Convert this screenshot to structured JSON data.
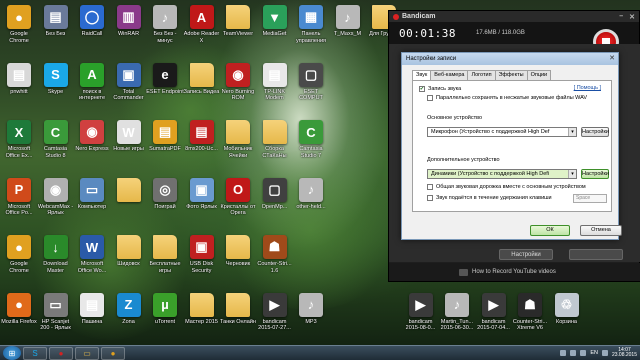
{
  "desktop_icons": [
    {
      "col": 0,
      "row": 0,
      "label": "Google Chrome",
      "icon": "chrome-icon",
      "color": "#e0a020",
      "glyph": "●"
    },
    {
      "col": 1,
      "row": 0,
      "label": "Без Без",
      "icon": "document-icon",
      "color": "#6a7a9a",
      "glyph": "▤"
    },
    {
      "col": 2,
      "row": 0,
      "label": "RaidCall",
      "icon": "raidcall-icon",
      "color": "#2a6ad0",
      "glyph": "◯"
    },
    {
      "col": 3,
      "row": 0,
      "label": "WinRAR",
      "icon": "winrar-icon",
      "color": "#8a3a8a",
      "glyph": "▥"
    },
    {
      "col": 4,
      "row": 0,
      "label": "Без Без - минус",
      "icon": "mp3-file-icon",
      "color": "#b8b8b8",
      "glyph": "♪"
    },
    {
      "col": 5,
      "row": 0,
      "label": "Adobe Reader X",
      "icon": "adobe-reader-icon",
      "color": "#c01818",
      "glyph": "A"
    },
    {
      "col": 6,
      "row": 0,
      "label": "TeamViewer",
      "icon": "folder-icon",
      "color": "#e6b84a",
      "glyph": ""
    },
    {
      "col": 7,
      "row": 0,
      "label": "MediaGet",
      "icon": "mediaget-icon",
      "color": "#2aa05a",
      "glyph": "▼"
    },
    {
      "col": 8,
      "row": 0,
      "label": "Панель управления",
      "icon": "control-panel-icon",
      "color": "#4a8ad0",
      "glyph": "▦"
    },
    {
      "col": 9,
      "row": 0,
      "label": "T_Maxs_M",
      "icon": "mp3-file-icon",
      "color": "#b8b8b8",
      "glyph": "♪"
    },
    {
      "col": 10,
      "row": 0,
      "label": "Для Группы",
      "icon": "folder-icon",
      "color": "#e6b84a",
      "glyph": ""
    },
    {
      "col": 0,
      "row": 1,
      "label": "pnwhitt",
      "icon": "document-icon",
      "color": "#d8d8d8",
      "glyph": "▤"
    },
    {
      "col": 1,
      "row": 1,
      "label": "Skype",
      "icon": "skype-icon",
      "color": "#1aa8e8",
      "glyph": "S"
    },
    {
      "col": 2,
      "row": 1,
      "label": "поиск в интернете",
      "icon": "search-green-icon",
      "color": "#2aa02a",
      "glyph": "A"
    },
    {
      "col": 3,
      "row": 1,
      "label": "Total Commander",
      "icon": "total-commander-icon",
      "color": "#3a6ab0",
      "glyph": "▣"
    },
    {
      "col": 4,
      "row": 1,
      "label": "ESET Endpoint",
      "icon": "eset-icon",
      "color": "#1a1a1a",
      "glyph": "e"
    },
    {
      "col": 5,
      "row": 1,
      "label": "Запись Видеа",
      "icon": "folder-icon",
      "color": "#e6b84a",
      "glyph": ""
    },
    {
      "col": 6,
      "row": 1,
      "label": "Nero Burning ROM",
      "icon": "nero-icon",
      "color": "#c02020",
      "glyph": "◉"
    },
    {
      "col": 7,
      "row": 1,
      "label": "TP-LINK Modem",
      "icon": "document-icon",
      "color": "#e8e8e8",
      "glyph": "▤"
    },
    {
      "col": 8,
      "row": 1,
      "label": "ESET COMPUT",
      "icon": "eset-icon",
      "color": "#4a4a4a",
      "glyph": "▢"
    },
    {
      "col": 0,
      "row": 2,
      "label": "Microsoft Office Ex...",
      "icon": "excel-icon",
      "color": "#1e7a3a",
      "glyph": "X"
    },
    {
      "col": 1,
      "row": 2,
      "label": "Camtasia Studio 8",
      "icon": "camtasia-icon",
      "color": "#3a9a3a",
      "glyph": "C"
    },
    {
      "col": 2,
      "row": 2,
      "label": "Nero Express",
      "icon": "nero-icon",
      "color": "#d04040",
      "glyph": "◉"
    },
    {
      "col": 3,
      "row": 2,
      "label": "Новые игры",
      "icon": "games-icon",
      "color": "#e0e0e0",
      "glyph": "W"
    },
    {
      "col": 4,
      "row": 2,
      "label": "SumatraPDF",
      "icon": "sumatra-icon",
      "color": "#e0a020",
      "glyph": "▤"
    },
    {
      "col": 5,
      "row": 2,
      "label": "8mx200-Uc...",
      "icon": "pdf-icon",
      "color": "#c02020",
      "glyph": "▤"
    },
    {
      "col": 6,
      "row": 2,
      "label": "Мобильник Ячейки",
      "icon": "folder-icon",
      "color": "#e6b84a",
      "glyph": ""
    },
    {
      "col": 7,
      "row": 2,
      "label": "Сборка СТаКаНы",
      "icon": "folder-icon",
      "color": "#e6b84a",
      "glyph": ""
    },
    {
      "col": 8,
      "row": 2,
      "label": "Camtasia Studio 7",
      "icon": "camtasia-icon",
      "color": "#3a9a3a",
      "glyph": "C"
    },
    {
      "col": 0,
      "row": 3,
      "label": "Microsoft Office Po...",
      "icon": "powerpoint-icon",
      "color": "#d04a1a",
      "glyph": "P"
    },
    {
      "col": 1,
      "row": 3,
      "label": "WebcamMax - Ярлык",
      "icon": "webcam-icon",
      "color": "#b0b0b0",
      "glyph": "◉"
    },
    {
      "col": 2,
      "row": 3,
      "label": "Компьютер",
      "icon": "computer-icon",
      "color": "#5a8ac0",
      "glyph": "▭"
    },
    {
      "col": 3,
      "row": 3,
      "label": "",
      "icon": "folder-icon",
      "color": "#e6b84a",
      "glyph": ""
    },
    {
      "col": 4,
      "row": 3,
      "label": "Поиграй",
      "icon": "gamepad-icon",
      "color": "#707070",
      "glyph": "◎"
    },
    {
      "col": 5,
      "row": 3,
      "label": "Фото Ярлык",
      "icon": "photo-icon",
      "color": "#6a9ad0",
      "glyph": "▣"
    },
    {
      "col": 6,
      "row": 3,
      "label": "Кристаллы от Opera",
      "icon": "opera-icon",
      "color": "#c01818",
      "glyph": "O"
    },
    {
      "col": 7,
      "row": 3,
      "label": "OpenMp...",
      "icon": "openmp-icon",
      "color": "#404040",
      "glyph": "▢"
    },
    {
      "col": 8,
      "row": 3,
      "label": "other-held...",
      "icon": "mp3-file-icon",
      "color": "#b8b8b8",
      "glyph": "♪"
    },
    {
      "col": 0,
      "row": 4,
      "label": "Google Chrome",
      "icon": "chrome-icon",
      "color": "#e0a020",
      "glyph": "●"
    },
    {
      "col": 1,
      "row": 4,
      "label": "Download Master",
      "icon": "download-master-icon",
      "color": "#2a8a2a",
      "glyph": "↓"
    },
    {
      "col": 2,
      "row": 4,
      "label": "Microsoft Office Wo...",
      "icon": "word-icon",
      "color": "#2a5aa8",
      "glyph": "W"
    },
    {
      "col": 3,
      "row": 4,
      "label": "Шидовск",
      "icon": "folder-icon",
      "color": "#e6b84a",
      "glyph": ""
    },
    {
      "col": 4,
      "row": 4,
      "label": "Бесплатные игры",
      "icon": "folder-icon",
      "color": "#e6b84a",
      "glyph": ""
    },
    {
      "col": 5,
      "row": 4,
      "label": "USB Disk Security",
      "icon": "usb-security-icon",
      "color": "#c02020",
      "glyph": "▣"
    },
    {
      "col": 6,
      "row": 4,
      "label": "Черновик",
      "icon": "folder-icon",
      "color": "#e6b84a",
      "glyph": ""
    },
    {
      "col": 7,
      "row": 4,
      "label": "Counter-Stri... 1.6",
      "icon": "counter-strike-icon",
      "color": "#a04a1a",
      "glyph": "☗"
    },
    {
      "col": 0,
      "row": 5,
      "label": "Mozilla Firefox",
      "icon": "firefox-icon",
      "color": "#e06a1a",
      "glyph": "●"
    },
    {
      "col": 1,
      "row": 5,
      "label": "HP Scanjet 200 - Ярлык",
      "icon": "scanner-icon",
      "color": "#7a7a7a",
      "glyph": "▭"
    },
    {
      "col": 2,
      "row": 5,
      "label": "Пашина",
      "icon": "document-icon",
      "color": "#e8e8e8",
      "glyph": "▤"
    },
    {
      "col": 3,
      "row": 5,
      "label": "Zona",
      "icon": "zona-icon",
      "color": "#1a8ad0",
      "glyph": "Z"
    },
    {
      "col": 4,
      "row": 5,
      "label": "uTorrent",
      "icon": "utorrent-icon",
      "color": "#3aa02a",
      "glyph": "µ"
    },
    {
      "col": 5,
      "row": 5,
      "label": "Мастер 2015",
      "icon": "folder-icon",
      "color": "#e6b84a",
      "glyph": ""
    },
    {
      "col": 6,
      "row": 5,
      "label": "Танки Онлайн",
      "icon": "folder-icon",
      "color": "#e6b84a",
      "glyph": ""
    },
    {
      "col": 7,
      "row": 5,
      "label": "bandicam 2015-07-27...",
      "icon": "video-file-icon",
      "color": "#3a3a3a",
      "glyph": "▶"
    },
    {
      "col": 8,
      "row": 5,
      "label": "MP3",
      "icon": "mp3-file-icon",
      "color": "#b8b8b8",
      "glyph": "♪"
    },
    {
      "col": 11,
      "row": 5,
      "label": "bandicam 2015-08-0...",
      "icon": "video-file-icon",
      "color": "#3a3a3a",
      "glyph": "▶"
    },
    {
      "col": 12,
      "row": 5,
      "label": "Martin_Tun... 2015-06-30...",
      "icon": "mp3-file-icon",
      "color": "#b8b8b8",
      "glyph": "♪"
    },
    {
      "col": 13,
      "row": 5,
      "label": "bandicam 2015-07-04...",
      "icon": "video-file-icon",
      "color": "#3a3a3a",
      "glyph": "▶"
    },
    {
      "col": 14,
      "row": 5,
      "label": "Counter-Stri... Xtreme V6",
      "icon": "counter-strike-icon",
      "color": "#2a2a2a",
      "glyph": "☗"
    },
    {
      "col": 15,
      "row": 5,
      "label": "Корзина",
      "icon": "recycle-bin-icon",
      "color": "#c0c8d0",
      "glyph": "♲"
    }
  ],
  "taskbar": {
    "start_icon": "windows-start-icon",
    "buttons": [
      {
        "icon": "skype-icon",
        "glyph": "S",
        "color": "#1aa8e8"
      },
      {
        "icon": "bandicam-record-icon",
        "glyph": "●",
        "color": "#d22222"
      },
      {
        "icon": "explorer-icon",
        "glyph": "▭",
        "color": "#e6b84a"
      },
      {
        "icon": "chrome-icon",
        "glyph": "●",
        "color": "#e0a020"
      }
    ],
    "language": "EN",
    "time": "14:07",
    "date": "23.08.2015"
  },
  "bandicam": {
    "title": "Bandicam",
    "timer": "00:01:38",
    "size": "17.6MB / 118.0GB",
    "bottom_link": "How to Record YouTube videos",
    "settings_button": "Настройки"
  },
  "dialog": {
    "title": "Настройки записи",
    "tabs": [
      "Звук",
      "Веб-камера",
      "Логотип",
      "Эффекты",
      "Опции"
    ],
    "help_link": "[ Помощь ]",
    "record_sound_label": "Запись звука",
    "record_sound_checked": true,
    "parallel_wav_label": "Параллельно сохранять в несжатые звуковые файлы WAV",
    "parallel_wav_checked": false,
    "primary_device_label": "Основное устройство",
    "primary_device_value": "Микрофон (Устройство с поддержкой High Def",
    "primary_settings_button": "Настройки",
    "secondary_device_label": "Дополнительное устройство",
    "secondary_device_value": "Динамики (Устройство с поддержкой High Defi",
    "secondary_settings_button": "Настройки",
    "mix_track_label": "Общая звуковая дорожка вместе с основным устройством",
    "mix_track_checked": false,
    "hotkey_label": "Звук подаётся в течение удержания клавиши",
    "hotkey_checked": false,
    "hotkey_value": "Space",
    "ok_button": "ОК",
    "cancel_button": "Отмена"
  }
}
